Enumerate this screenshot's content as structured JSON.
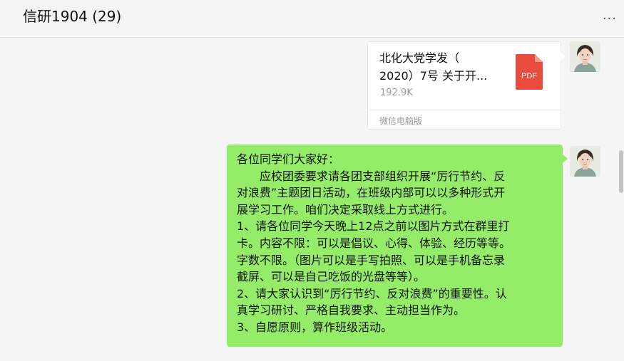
{
  "header": {
    "title": "信研1904 (29)",
    "more_label": "···"
  },
  "messages": [
    {
      "type": "file",
      "file_name_line1": "北化大党学发（",
      "file_name_line2": "2020）7号  关于开...",
      "file_size": "192.9K",
      "file_icon_label": "PDF",
      "source": "微信电脑版"
    },
    {
      "type": "text",
      "lines": [
        "各位同学们大家好：",
        "　　应校团委要求请各团支部组织开展“厉行节约、反",
        "对浪费”主题团日活动，在班级内部可以以多种形式开",
        "展学习工作。咱们决定采取线上方式进行。",
        "1、请各位同学今天晚上12点之前以图片方式在群里打",
        "卡。内容不限：可以是倡议、心得、体验、经历等等。",
        "字数不限。（图片可以是手写拍照、可以是手机备忘录",
        "截屏、可以是自己吃饭的光盘等等）。",
        "2、请大家认识到“厉行节约、反对浪费”的重要性。认",
        "真学习研讨、严格自我要求、主动担当作为。",
        "3、自愿原则，算作班级活动。"
      ]
    }
  ],
  "colors": {
    "sent_bubble": "#95ec69",
    "pdf_icon": "#e94b3c",
    "background": "#f5f5f5"
  }
}
